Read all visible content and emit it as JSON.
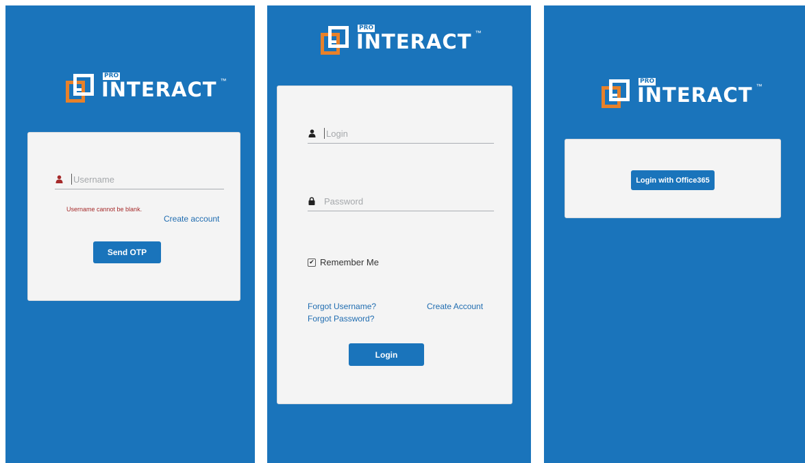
{
  "theme": {
    "background": "#1a74bb",
    "card": "#f4f4f4",
    "button": "#1a74bb",
    "link": "#1f6cb0",
    "logo_orange": "#e8812a"
  },
  "logo": {
    "pro": "PRO",
    "word": "INTERACT",
    "tm": "™"
  },
  "otp_panel": {
    "username_placeholder": "Username",
    "user_icon": "user-icon",
    "error_text": "Username cannot be blank.",
    "create_account": "Create account",
    "send_otp": "Send OTP"
  },
  "login_panel": {
    "login_placeholder": "Login",
    "password_placeholder": "Password",
    "user_icon": "user-icon",
    "lock_icon": "lock-icon",
    "remember_me": "Remember Me",
    "remember_checked": "✔",
    "forgot_username": "Forgot Username?",
    "forgot_password": "Forgot Password?",
    "create_account": "Create Account",
    "login_button": "Login"
  },
  "office_panel": {
    "office_button": "Login with Office365"
  }
}
